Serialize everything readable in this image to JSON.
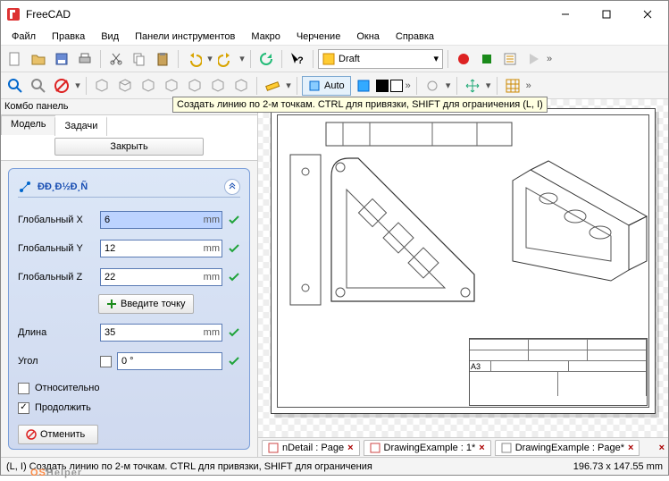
{
  "app": {
    "title": "FreeCAD"
  },
  "menu": {
    "file": "Файл",
    "edit": "Правка",
    "view": "Вид",
    "toolbars": "Панели инструментов",
    "macro": "Макро",
    "draft": "Черчение",
    "windows": "Окна",
    "help": "Справка"
  },
  "workbench": {
    "label": "Draft"
  },
  "auto": {
    "label": "Auto"
  },
  "tooltip": {
    "text": "Создать линию по 2-м точкам. CTRL для привязки, SHIFT для ограничения (L, I)"
  },
  "panel": {
    "title": "Комбо панель",
    "tabs": {
      "model": "Модель",
      "tasks": "Задачи"
    },
    "close": "Закрыть",
    "task_title": "ÐÐ¸Ð½Ð¸Ñ",
    "fields": {
      "gx": {
        "label": "Глобальный X",
        "value": "6",
        "unit": "mm"
      },
      "gy": {
        "label": "Глобальный Y",
        "value": "12",
        "unit": "mm"
      },
      "gz": {
        "label": "Глобальный Z",
        "value": "22",
        "unit": "mm"
      },
      "length": {
        "label": "Длина",
        "value": "35",
        "unit": "mm"
      },
      "angle": {
        "label": "Угол",
        "value": "0 °",
        "unit": ""
      }
    },
    "enter_point": "Введите точку",
    "relative": "Относительно",
    "continue": "Продолжить",
    "cancel": "Отменить"
  },
  "doc_tabs": {
    "t1": "nDetail : Page",
    "t2": "DrawingExample : 1*",
    "t3": "DrawingExample : Page*"
  },
  "titleblock": {
    "format": "A3"
  },
  "status": {
    "left": "(L, I) Создать линию по 2-м точкам. CTRL для привязки, SHIFT для ограничения",
    "right": "196.73 x 147.55 mm"
  },
  "watermark": {
    "a": "OS",
    "b": "Helper"
  }
}
